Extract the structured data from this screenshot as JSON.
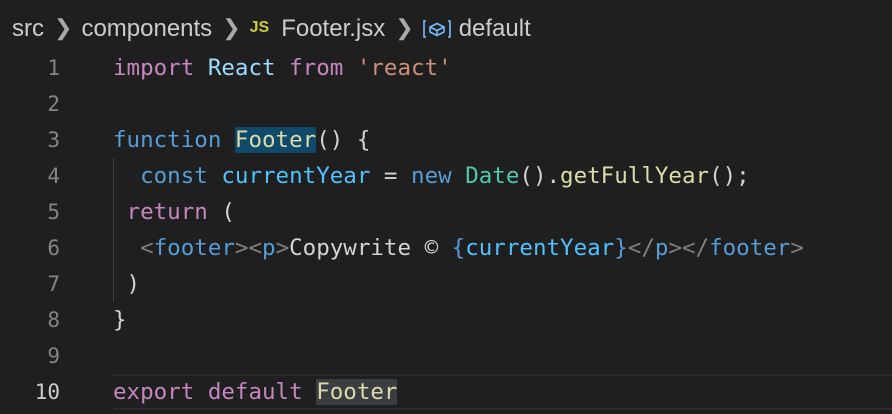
{
  "breadcrumb": {
    "folder1": "src",
    "folder2": "components",
    "file_badge": "JS",
    "file": "Footer.jsx",
    "symbol": "default"
  },
  "line_numbers": [
    "1",
    "2",
    "3",
    "4",
    "5",
    "6",
    "7",
    "8",
    "9",
    "10"
  ],
  "code": {
    "l1": {
      "import": "import",
      "react_id": "React",
      "from": "from",
      "module": "'react'"
    },
    "l3": {
      "function": "function",
      "name": "Footer",
      "rest": "() {"
    },
    "l4": {
      "const": "const",
      "var": "currentYear",
      "eq": " = ",
      "new": "new",
      "date": "Date",
      "p1": "().",
      "method": "getFullYear",
      "p2": "();"
    },
    "l5": {
      "return": "return",
      "paren": " ("
    },
    "l6": {
      "lt1": "<",
      "footer_open": "footer",
      "gt1": ">",
      "lt2": "<",
      "p_open": "p",
      "gt2": ">",
      "text": "Copywrite © ",
      "brace_open": "{",
      "expr": "currentYear",
      "brace_close": "}",
      "lt3": "</",
      "p_close": "p",
      "gt3": ">",
      "lt4": "</",
      "footer_close": "footer",
      "gt4": ">"
    },
    "l7": {
      "paren": ")"
    },
    "l8": {
      "brace": "}"
    },
    "l10": {
      "export": "export",
      "default": "default",
      "name": "Footer"
    }
  }
}
